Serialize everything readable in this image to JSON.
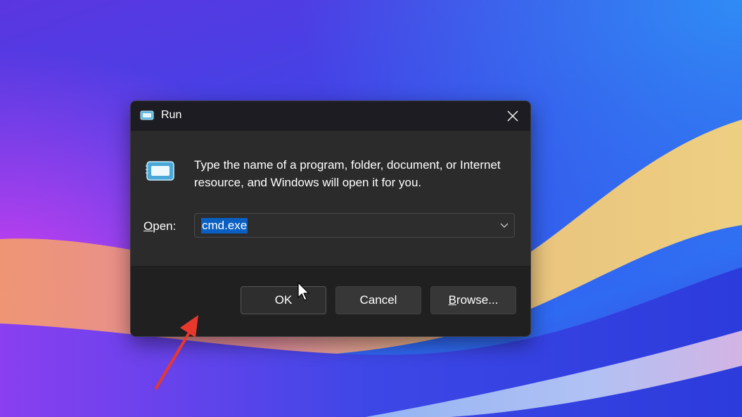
{
  "dialog": {
    "title": "Run",
    "description": "Type the name of a program, folder, document, or Internet resource, and Windows will open it for you.",
    "open_label_mnemonic": "O",
    "open_label_rest": "pen:",
    "open_value": "cmd.exe",
    "buttons": {
      "ok": "OK",
      "cancel": "Cancel",
      "browse_mnemonic": "B",
      "browse_rest": "rowse..."
    }
  },
  "icons": {
    "title_icon": "run-app-icon",
    "big_icon": "run-app-icon",
    "close": "close-icon",
    "dropdown": "chevron-down-icon",
    "cursor": "mouse-cursor-icon",
    "annotation": "red-arrow-annotation"
  },
  "colors": {
    "selection": "#0a5fc2",
    "dialog_bg": "#202020",
    "body_bg": "#2b2b2b",
    "annotation": "#e8382c"
  }
}
